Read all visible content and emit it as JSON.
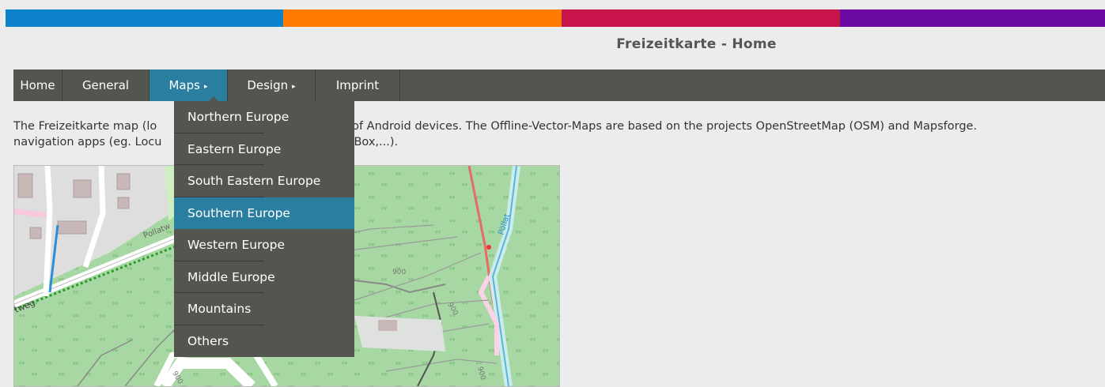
{
  "colors": {
    "bar": [
      "#0b82c9",
      "#fe7a00",
      "#c7144a",
      "#6a0aa3"
    ],
    "nav_bg": "#55554f",
    "accent": "#2a7fa1"
  },
  "header": {
    "title": "Freizeitkarte - Home"
  },
  "nav": {
    "items": [
      {
        "label": "Home",
        "has_submenu": false
      },
      {
        "label": "General",
        "has_submenu": false
      },
      {
        "label": "Maps",
        "has_submenu": true
      },
      {
        "label": "Design",
        "has_submenu": true
      },
      {
        "label": "Imprint",
        "has_submenu": false
      }
    ],
    "active": "Maps",
    "submenu_arrow": "▸"
  },
  "intro": {
    "line1_a": "The Freizeitkarte map (lo",
    "line1_b": "users of Android devices. The Offline-Vector-Maps are based on the projects OpenStreetMap (OSM) and Mapsforge.",
    "line2_a": "navigation apps (eg. Locu",
    "line2_b": "acheBox,...)."
  },
  "map": {
    "labels": {
      "street1": "Pollatw",
      "street2": "tweg",
      "river": "Pöllat",
      "contour1": "900",
      "contour2": "900",
      "contour3": "900",
      "contour4": "900"
    }
  },
  "maps_menu": {
    "items": [
      "Northern Europe",
      "Eastern Europe",
      "South Eastern Europe",
      "Southern Europe",
      "Western Europe",
      "Middle Europe",
      "Mountains",
      "Others"
    ],
    "highlighted": "Southern Europe"
  }
}
